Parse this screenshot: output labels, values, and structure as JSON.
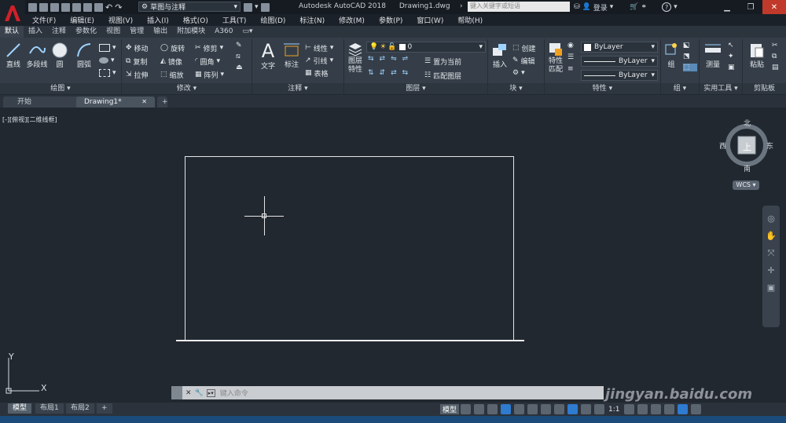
{
  "app": {
    "title": "Autodesk AutoCAD 2018",
    "document": "Drawing1.dwg",
    "logo": "A",
    "workspace": "草图与注释",
    "search_placeholder": "键入关键字或短语",
    "login": "登录"
  },
  "menus": [
    "文件(F)",
    "编辑(E)",
    "视图(V)",
    "插入(I)",
    "格式(O)",
    "工具(T)",
    "绘图(D)",
    "标注(N)",
    "修改(M)",
    "参数(P)",
    "窗口(W)",
    "帮助(H)"
  ],
  "ribbon_tabs": [
    "默认",
    "插入",
    "注释",
    "参数化",
    "视图",
    "管理",
    "输出",
    "附加模块",
    "A360"
  ],
  "ribbon": {
    "draw": {
      "title": "绘图",
      "line": "直线",
      "polyline": "多段线",
      "circle": "圆",
      "arc": "圆弧"
    },
    "modify": {
      "title": "修改",
      "move": "移动",
      "rotate": "旋转",
      "trim": "修剪",
      "copy": "复制",
      "mirror": "镜像",
      "fillet": "圆角",
      "stretch": "拉伸",
      "scale": "缩放",
      "array": "阵列"
    },
    "annotation": {
      "title": "注释",
      "text": "文字",
      "dimension": "标注",
      "linear": "线性",
      "leader": "引线",
      "table": "表格"
    },
    "layers": {
      "title": "图层",
      "layer_properties": "图层\n特性",
      "layer_value": "0",
      "set_current": "置为当前",
      "match_layer": "匹配图层"
    },
    "block": {
      "title": "块",
      "insert": "插入",
      "create": "创建",
      "edit": "编辑"
    },
    "properties": {
      "title": "特性",
      "match": "特性\n匹配",
      "color": "ByLayer",
      "linetype": "ByLayer",
      "lineweight": "ByLayer"
    },
    "groups": {
      "title": "组",
      "group": "组"
    },
    "utilities": {
      "title": "实用工具",
      "measure": "测量"
    },
    "clipboard": {
      "title": "剪贴板",
      "paste": "粘贴"
    }
  },
  "doc_tabs": [
    "开始",
    "Drawing1*"
  ],
  "viewport_label": "[-][俯视][二维线框]",
  "viewcube": {
    "north": "北",
    "south": "南",
    "east": "东",
    "west": "西",
    "top": "上",
    "wcs": "WCS"
  },
  "ucs": {
    "x": "X",
    "y": "Y"
  },
  "command_placeholder": "键入命令",
  "watermark": "jingyan.baidu.com",
  "layout_tabs": [
    "模型",
    "布局1",
    "布局2"
  ],
  "status": {
    "model": "模型",
    "scale": "1:1"
  }
}
